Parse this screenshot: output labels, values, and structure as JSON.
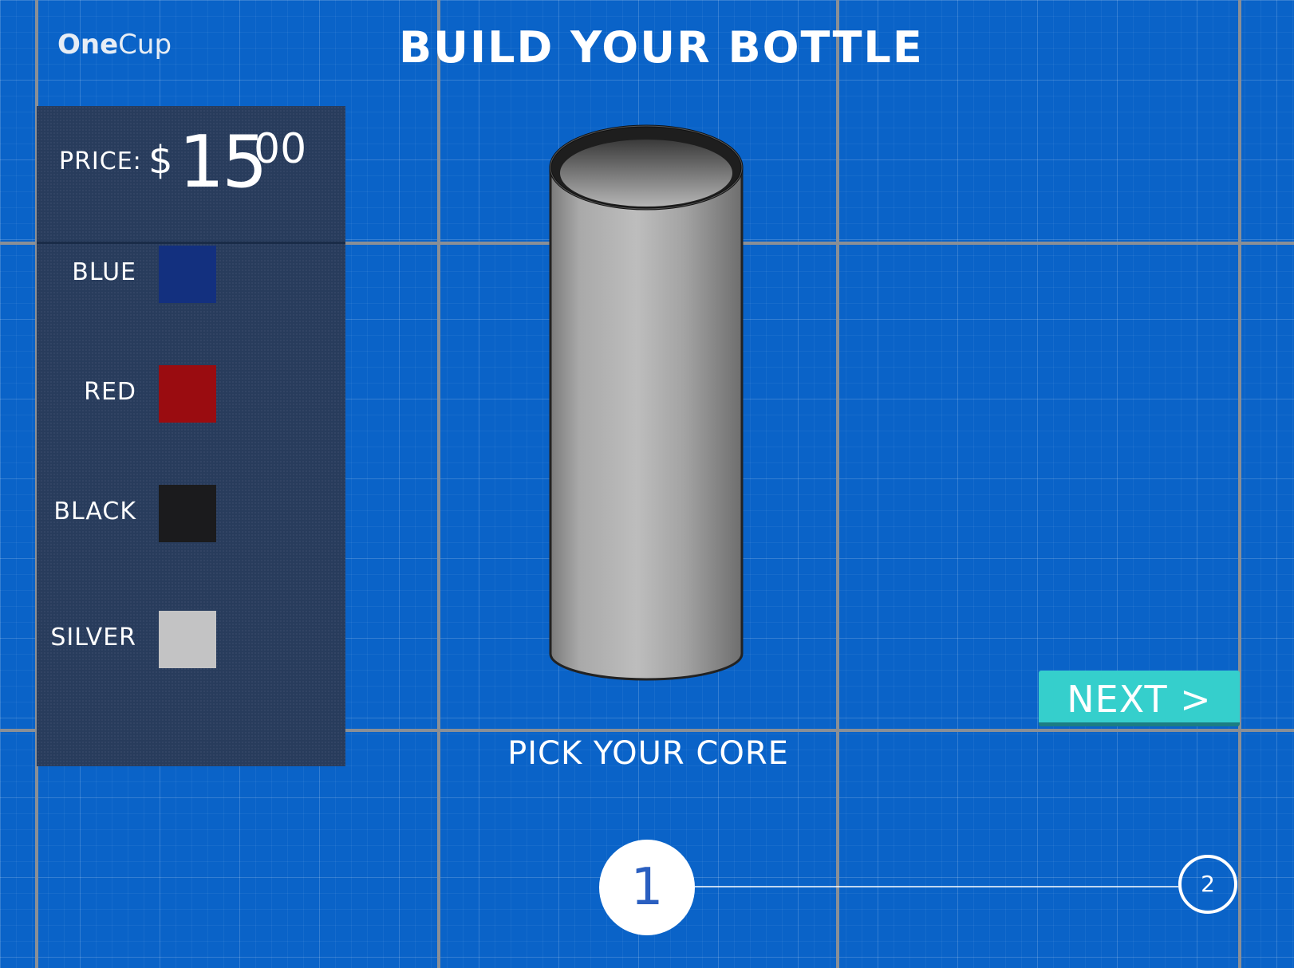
{
  "app": {
    "logo_bold": "One",
    "logo_regular": "Cup",
    "title": "BUILD YOUR BOTTLE"
  },
  "price": {
    "label": "PRICE:",
    "currency": "$",
    "whole": "15",
    "cents": "00"
  },
  "colors": [
    {
      "label": "BLUE",
      "hex": "#13307f"
    },
    {
      "label": "RED",
      "hex": "#9a0c10"
    },
    {
      "label": "BLACK",
      "hex": "#1b1b1d"
    },
    {
      "label": "SILVER",
      "hex": "#c3c3c4"
    }
  ],
  "step": {
    "caption": "PICK YOUR CORE",
    "next_label": "NEXT >",
    "current": "1",
    "next_step": "2"
  },
  "theme": {
    "background": "#0a63c8",
    "panel": "#283c5c",
    "accent": "#35cfcc"
  }
}
